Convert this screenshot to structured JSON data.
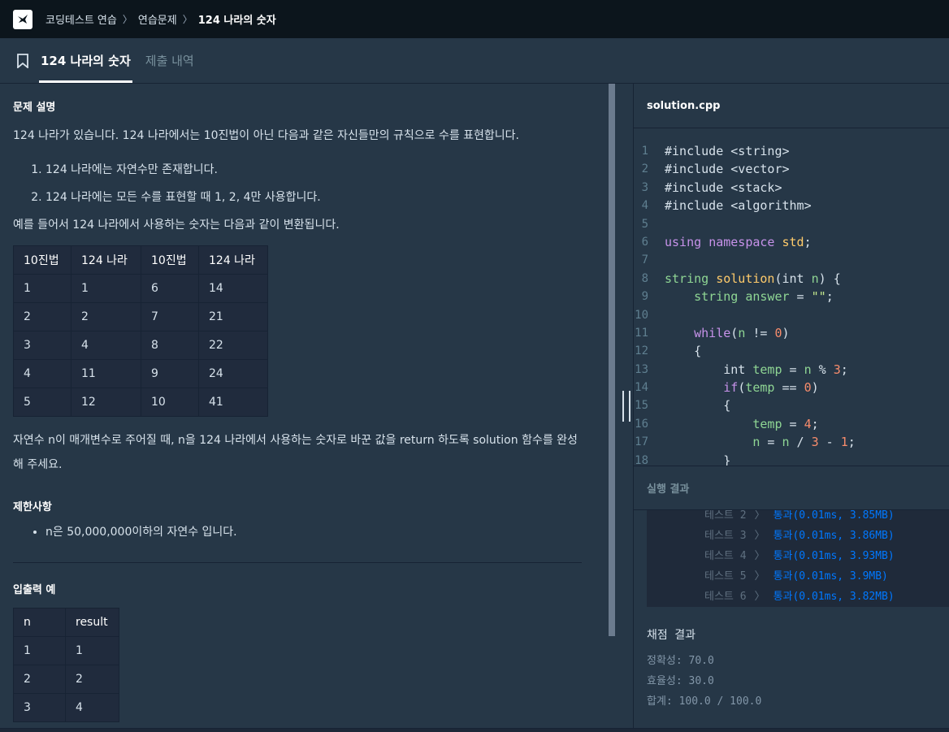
{
  "breadcrumb": {
    "items": [
      "코딩테스트 연습",
      "연습문제"
    ],
    "current": "124 나라의 숫자"
  },
  "tabs": {
    "active": "124 나라의 숫자",
    "inactive": "제출 내역"
  },
  "problem": {
    "section_title": "문제 설명",
    "intro": "124 나라가 있습니다. 124 나라에서는 10진법이 아닌 다음과 같은 자신들만의 규칙으로 수를 표현합니다.",
    "rules": [
      "124 나라에는 자연수만 존재합니다.",
      "124 나라에는 모든 수를 표현할 때 1, 2, 4만 사용합니다."
    ],
    "example_intro": "예를 들어서 124 나라에서 사용하는 숫자는 다음과 같이 변환됩니다.",
    "conversion_table": {
      "headers": [
        "10진법",
        "124 나라",
        "10진법",
        "124 나라"
      ],
      "rows": [
        [
          "1",
          "1",
          "6",
          "14"
        ],
        [
          "2",
          "2",
          "7",
          "21"
        ],
        [
          "3",
          "4",
          "8",
          "22"
        ],
        [
          "4",
          "11",
          "9",
          "24"
        ],
        [
          "5",
          "12",
          "10",
          "41"
        ]
      ]
    },
    "task": "자연수 n이 매개변수로 주어질 때, n을 124 나라에서 사용하는 숫자로 바꾼 값을 return 하도록 solution 함수를 완성해 주세요.",
    "constraints_title": "제한사항",
    "constraints": [
      "n은 50,000,000이하의 자연수 입니다."
    ],
    "io_title": "입출력 예",
    "io_table": {
      "headers": [
        "n",
        "result"
      ],
      "rows": [
        [
          "1",
          "1"
        ],
        [
          "2",
          "2"
        ],
        [
          "3",
          "4"
        ]
      ]
    }
  },
  "editor": {
    "filename": "solution.cpp",
    "line_numbers": [
      "1",
      "2",
      "3",
      "4",
      "5",
      "6",
      "7",
      "8",
      "9",
      "10",
      "11",
      "12",
      "13",
      "14",
      "15",
      "16",
      "17",
      "18"
    ]
  },
  "results": {
    "title": "실행 결과",
    "tests": [
      {
        "label": "테스트 2",
        "status": "통과",
        "detail": "(0.01ms, 3.85MB)"
      },
      {
        "label": "테스트 3",
        "status": "통과",
        "detail": "(0.01ms, 3.86MB)"
      },
      {
        "label": "테스트 4",
        "status": "통과",
        "detail": "(0.01ms, 3.93MB)"
      },
      {
        "label": "테스트 5",
        "status": "통과",
        "detail": "(0.01ms, 3.9MB)"
      },
      {
        "label": "테스트 6",
        "status": "통과",
        "detail": "(0.01ms, 3.82MB)"
      }
    ],
    "grading_title": "채점 결과",
    "accuracy": "정확성: 70.0",
    "efficiency": "효율성: 30.0",
    "total": "합계: 100.0 / 100.0"
  },
  "colors": {
    "background": "#263747",
    "topbar": "#0c151c",
    "pass": "#0078ff"
  }
}
